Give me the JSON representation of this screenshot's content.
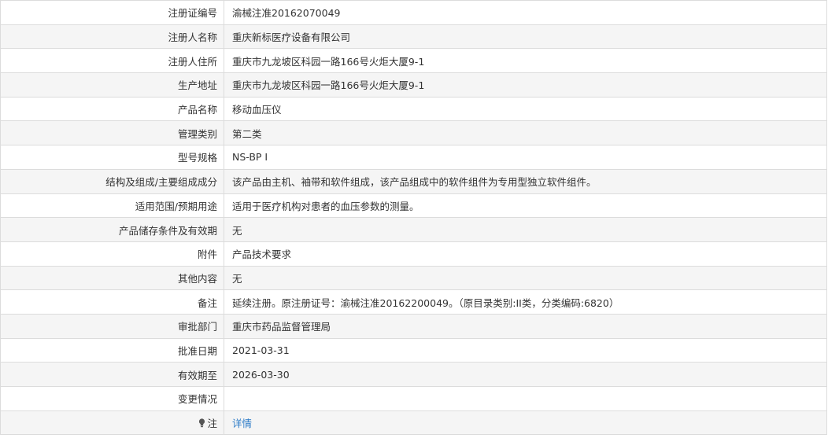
{
  "rows": [
    {
      "label": "注册证编号",
      "value": "渝械注准20162070049"
    },
    {
      "label": "注册人名称",
      "value": "重庆新标医疗设备有限公司"
    },
    {
      "label": "注册人住所",
      "value": "重庆市九龙坡区科园一路166号火炬大厦9-1"
    },
    {
      "label": "生产地址",
      "value": "重庆市九龙坡区科园一路166号火炬大厦9-1"
    },
    {
      "label": "产品名称",
      "value": "移动血压仪"
    },
    {
      "label": "管理类别",
      "value": "第二类"
    },
    {
      "label": "型号规格",
      "value": "NS-BP I"
    },
    {
      "label": "结构及组成/主要组成成分",
      "value": "该产品由主机、袖带和软件组成，该产品组成中的软件组件为专用型独立软件组件。"
    },
    {
      "label": "适用范围/预期用途",
      "value": "适用于医疗机构对患者的血压参数的测量。"
    },
    {
      "label": "产品储存条件及有效期",
      "value": "无"
    },
    {
      "label": "附件",
      "value": "产品技术要求"
    },
    {
      "label": "其他内容",
      "value": "无"
    },
    {
      "label": "备注",
      "value": "延续注册。原注册证号：渝械注准20162200049。（原目录类别:II类，分类编码:6820）"
    },
    {
      "label": "审批部门",
      "value": "重庆市药品监督管理局"
    },
    {
      "label": "批准日期",
      "value": "2021-03-31"
    },
    {
      "label": "有效期至",
      "value": "2026-03-30"
    },
    {
      "label": "变更情况",
      "value": ""
    }
  ],
  "note_row": {
    "label": "注",
    "icon": "lightbulb-icon",
    "link_text": "详情",
    "link_color": "#2a7ac7"
  },
  "colors": {
    "border": "#dcdcdc",
    "stripe": "#f5f5f5",
    "text": "#333333"
  }
}
